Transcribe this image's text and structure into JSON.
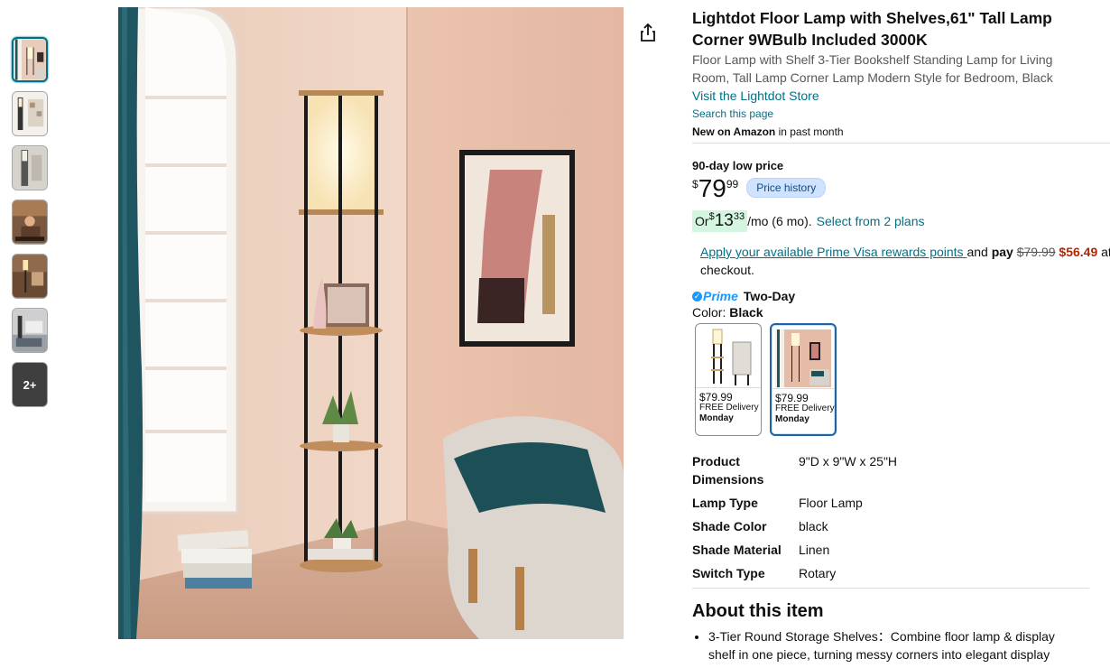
{
  "thumbnails": {
    "more_label": "2+"
  },
  "product": {
    "title": "Lightdot Floor Lamp with Shelves,61\" Tall Lamp Corner 9WBulb Included 3000K",
    "subtitle": "Floor Lamp with Shelf 3-Tier Bookshelf Standing Lamp for Living Room, Tall Lamp Corner Lamp Modern Style for Bedroom, Black",
    "store_link": "Visit the Lightdot Store",
    "search_page": "Search this page",
    "new_bold": "New on Amazon",
    "new_rest": " in past month"
  },
  "price": {
    "low_label": "90-day low price",
    "symbol": "$",
    "whole": "79",
    "fraction": "99",
    "history_button": "Price history"
  },
  "monthly": {
    "or": "Or ",
    "symbol": "$",
    "whole": "13",
    "fraction": "33",
    "per": "/mo (6 mo).",
    "plans_link": "Select from 2 plans"
  },
  "prime_visa": {
    "link": "Apply your available Prime Visa rewards points ",
    "and": "and ",
    "pay": "pay",
    "old_price": "$79.99",
    "new_price": "$56.49",
    "trail": " at",
    "checkout": "checkout."
  },
  "delivery": {
    "prime": "Prime",
    "two_day": "Two-Day"
  },
  "color": {
    "label": "Color: ",
    "value": "Black",
    "options": [
      {
        "price": "$79.99",
        "delivery": "FREE Delivery",
        "day": "Monday"
      },
      {
        "price": "$79.99",
        "delivery": "FREE Delivery",
        "day": "Monday"
      }
    ]
  },
  "specs": [
    {
      "key": "Product Dimensions",
      "value": "9\"D x 9\"W x 25\"H"
    },
    {
      "key": "Lamp Type",
      "value": "Floor Lamp"
    },
    {
      "key": "Shade Color",
      "value": "black"
    },
    {
      "key": "Shade Material",
      "value": "Linen"
    },
    {
      "key": "Switch Type",
      "value": "Rotary"
    }
  ],
  "about": {
    "heading": "About this item",
    "bullets": [
      "3-Tier Round Storage Shelves：Combine floor lamp & display shelf in one piece, turning messy corners into elegant display"
    ]
  },
  "colors": {
    "link": "#007185",
    "price_red": "#b12704",
    "prime_blue": "#1a98ff",
    "selected_border": "#2162a1"
  }
}
